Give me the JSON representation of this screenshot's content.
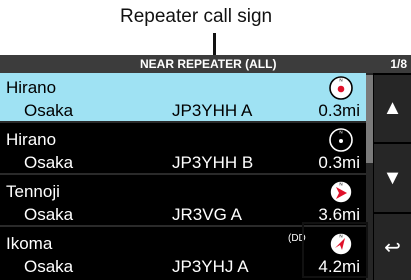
{
  "callout": {
    "label": "Repeater call sign"
  },
  "header": {
    "title": "NEAR REPEATER (ALL)",
    "page": "1/8"
  },
  "rows": [
    {
      "name": "Hirano",
      "city": "Osaka",
      "callsign": "JP3YHH A",
      "distance": "0.3mi",
      "indicator": ""
    },
    {
      "name": "Hirano",
      "city": "Osaka",
      "callsign": "JP3YHH B",
      "distance": "0.3mi",
      "indicator": ""
    },
    {
      "name": "Tennoji",
      "city": "Osaka",
      "callsign": "JR3VG  A",
      "distance": "3.6mi",
      "indicator": ""
    },
    {
      "name": "Ikoma",
      "city": "Osaka",
      "callsign": "JP3YHJ A",
      "distance": "4.2mi",
      "indicator": "(DD"
    }
  ],
  "side_buttons": {
    "up": "▲",
    "down": "▼",
    "back": "↩"
  },
  "colors": {
    "selected_row": "#9fe2f3",
    "compass_red": "#e0102a",
    "background": "#000000"
  }
}
